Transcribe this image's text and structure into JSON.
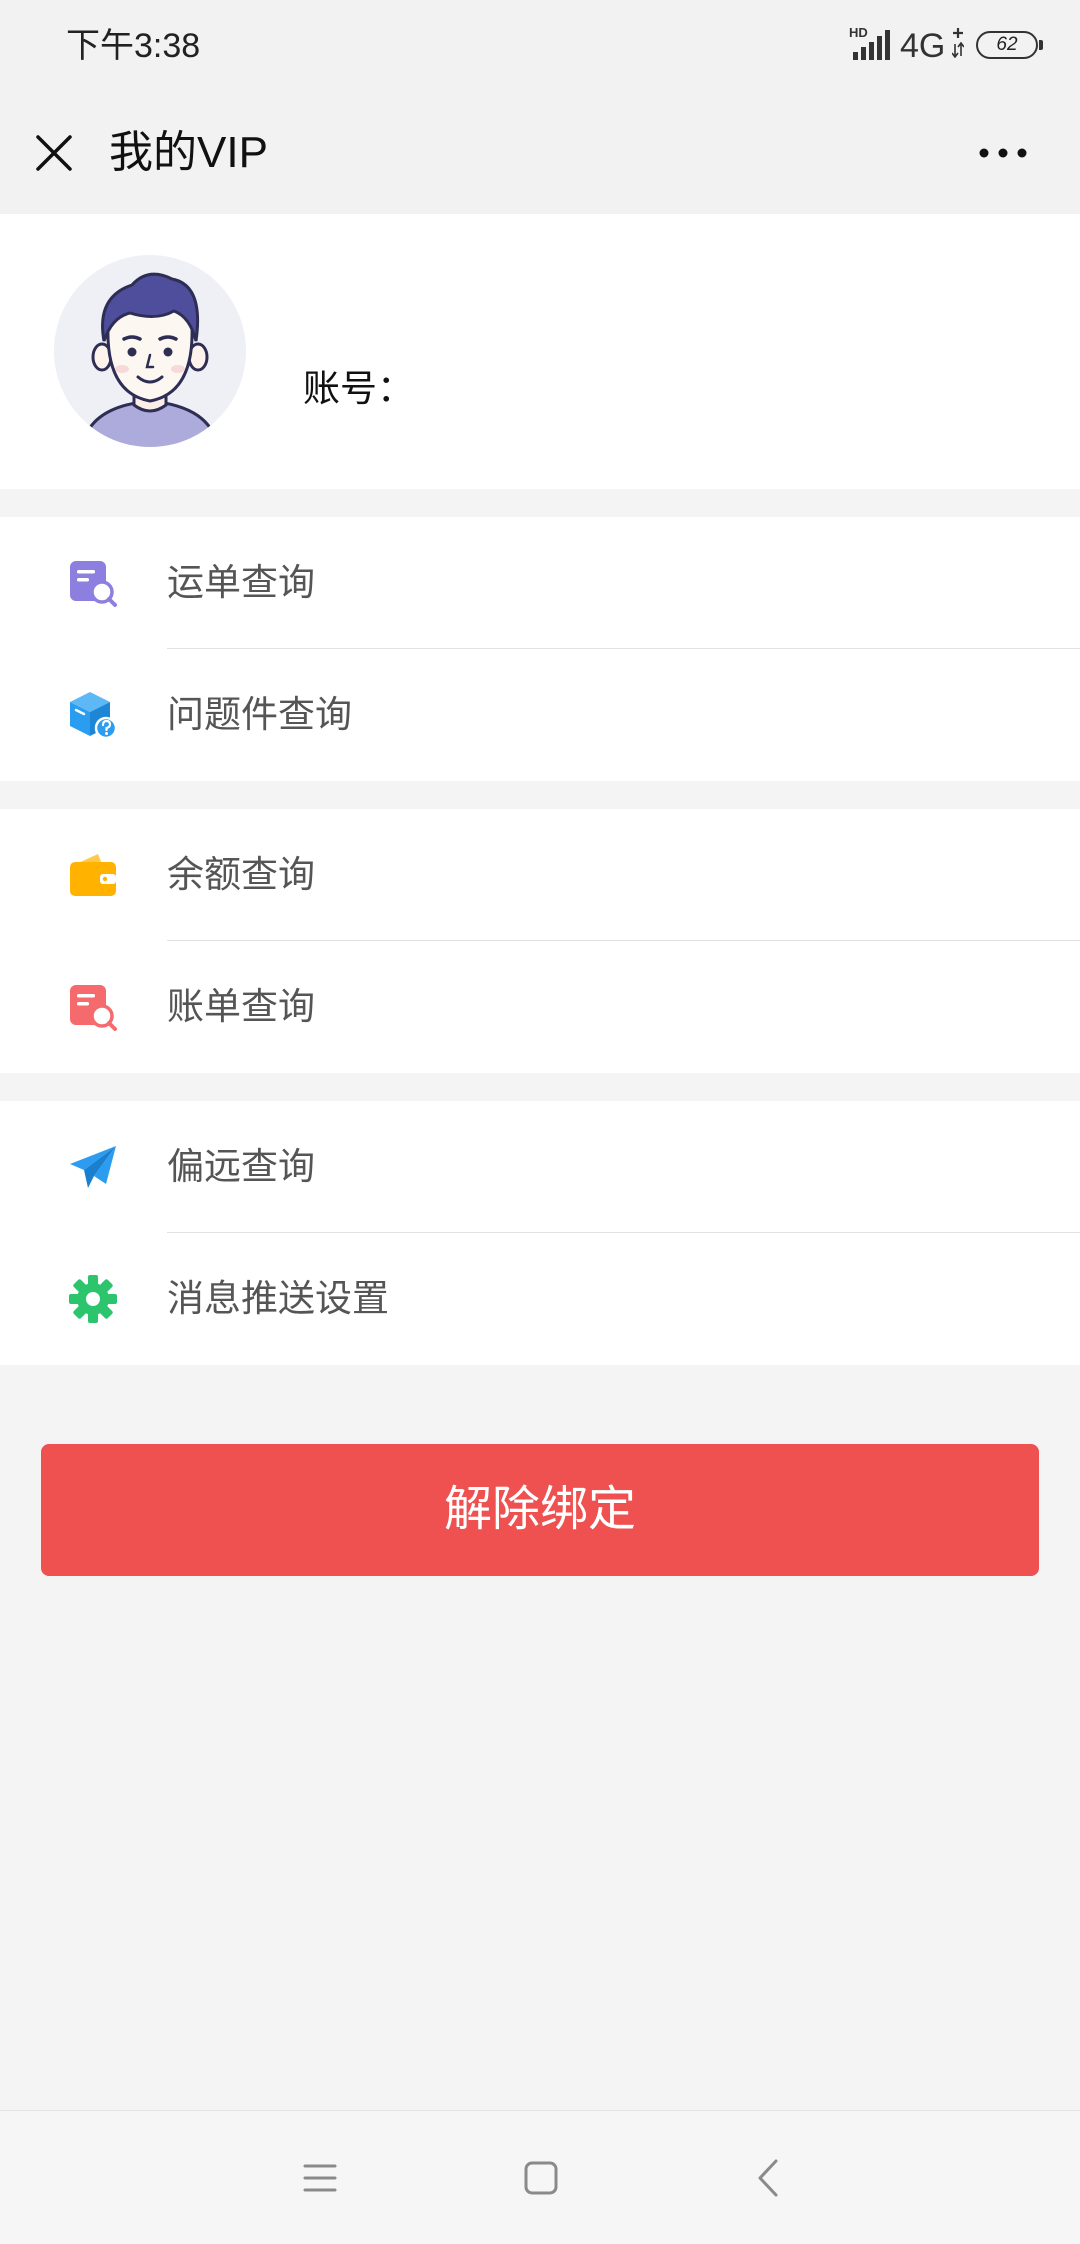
{
  "status_bar": {
    "time": "下午3:38",
    "hd": "HD",
    "network": "4G",
    "network_arrows": "+↓↑",
    "battery": "62",
    "signal_icon": "signal-bars-icon",
    "battery_icon": "battery-icon"
  },
  "nav": {
    "title": "我的VIP",
    "close_icon": "close-icon",
    "more_icon": "more-icon"
  },
  "profile": {
    "avatar_icon": "avatar",
    "account_label": "账号："
  },
  "menu_groups": [
    {
      "items": [
        {
          "label": "运单查询",
          "icon": "waybill-search-icon"
        },
        {
          "label": "问题件查询",
          "icon": "problem-package-icon"
        }
      ]
    },
    {
      "items": [
        {
          "label": "余额查询",
          "icon": "wallet-icon"
        },
        {
          "label": "账单查询",
          "icon": "bill-search-icon"
        }
      ]
    },
    {
      "items": [
        {
          "label": "偏远查询",
          "icon": "paper-plane-icon"
        },
        {
          "label": "消息推送设置",
          "icon": "gear-icon"
        }
      ]
    }
  ],
  "unbind_button": {
    "label": "解除绑定"
  },
  "system_nav": {
    "icons": [
      "menu-icon",
      "home-icon",
      "back-icon"
    ]
  },
  "colors": {
    "page_background": "#F4F4F4",
    "bar_background": "#F2F2F2",
    "card_background": "#FFFFFF",
    "button_red": "#EF5050",
    "waybill_purple": "#8C7FE0",
    "package_blue": "#2A9DF0",
    "wallet_orange": "#FFB300",
    "bill_red": "#F56A6C",
    "plane_blue": "#2C9CF0",
    "gear_green": "#2DC46E"
  }
}
